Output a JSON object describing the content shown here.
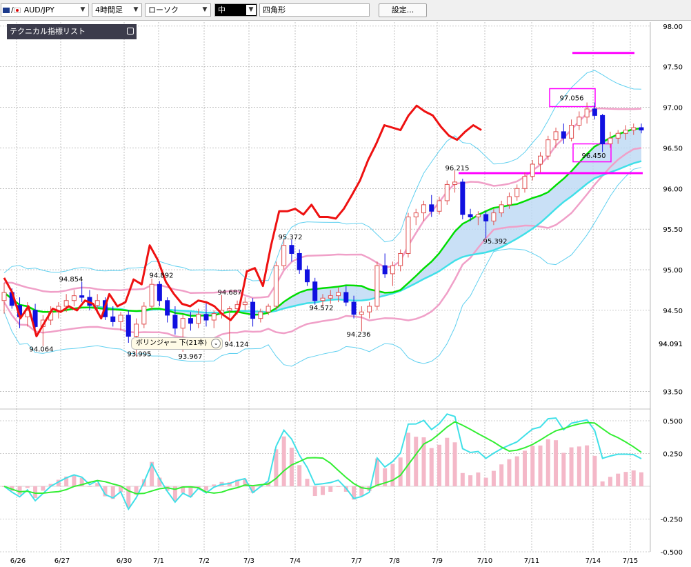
{
  "toolbar": {
    "symbol": "AUD/JPY",
    "timeframe": "4時間足",
    "chart_type": "ローソク",
    "line_width": "中",
    "drawing_tool": "四角形",
    "settings_label": "設定..."
  },
  "indicator_panel": {
    "title": "テクニカル指標リスト"
  },
  "tooltip": {
    "label": "ボリンジャー 下(21本)"
  },
  "colors": {
    "up_candle": "#e05050",
    "down_candle": "#1010e0",
    "bb_mid": "#00dd00",
    "bb_1": "#f0a0c8",
    "bb_2": "#60d0f0",
    "price_line": "#ee1111",
    "annotation": "#ff00ff",
    "macd_hist": "#f4b8c8",
    "macd_line": "#40e0e8",
    "signal_line": "#33ee33"
  },
  "chart_data": [
    {
      "type": "candlestick",
      "x_labels": [
        "6/26",
        "6/27",
        "6/30",
        "7/1",
        "7/2",
        "7/3",
        "7/4",
        "7/7",
        "7/8",
        "7/9",
        "7/10",
        "7/11",
        "7/14",
        "7/15"
      ],
      "y_ticks": [
        "98.00",
        "97.50",
        "97.00",
        "96.50",
        "96.00",
        "95.50",
        "95.00",
        "94.50",
        "94.091",
        "93.50"
      ],
      "ylim": [
        93.42,
        98.05
      ],
      "current_price": "94.091",
      "candles": [
        {
          "o": 94.62,
          "h": 94.84,
          "l": 94.46,
          "c": 94.72
        },
        {
          "o": 94.72,
          "h": 94.77,
          "l": 94.52,
          "c": 94.56
        },
        {
          "o": 94.56,
          "h": 94.66,
          "l": 94.28,
          "c": 94.42
        },
        {
          "o": 94.42,
          "h": 94.6,
          "l": 94.3,
          "c": 94.5
        },
        {
          "o": 94.5,
          "h": 94.58,
          "l": 94.2,
          "c": 94.3
        },
        {
          "o": 94.3,
          "h": 94.44,
          "l": 94.06,
          "c": 94.38
        },
        {
          "o": 94.38,
          "h": 94.55,
          "l": 94.32,
          "c": 94.48
        },
        {
          "o": 94.48,
          "h": 94.6,
          "l": 94.4,
          "c": 94.55
        },
        {
          "o": 94.55,
          "h": 94.7,
          "l": 94.48,
          "c": 94.62
        },
        {
          "o": 94.62,
          "h": 94.75,
          "l": 94.55,
          "c": 94.68
        },
        {
          "o": 94.68,
          "h": 94.85,
          "l": 94.6,
          "c": 94.66
        },
        {
          "o": 94.66,
          "h": 94.75,
          "l": 94.5,
          "c": 94.56
        },
        {
          "o": 94.56,
          "h": 94.7,
          "l": 94.5,
          "c": 94.62
        },
        {
          "o": 94.62,
          "h": 94.66,
          "l": 94.38,
          "c": 94.42
        },
        {
          "o": 94.42,
          "h": 94.55,
          "l": 94.3,
          "c": 94.36
        },
        {
          "o": 94.36,
          "h": 94.48,
          "l": 94.25,
          "c": 94.44
        },
        {
          "o": 94.44,
          "h": 94.5,
          "l": 94.1,
          "c": 94.18
        },
        {
          "o": 94.18,
          "h": 94.4,
          "l": 93.93,
          "c": 94.33
        },
        {
          "o": 94.33,
          "h": 94.6,
          "l": 94.28,
          "c": 94.55
        },
        {
          "o": 94.55,
          "h": 94.89,
          "l": 94.5,
          "c": 94.82
        },
        {
          "o": 94.82,
          "h": 94.86,
          "l": 94.55,
          "c": 94.62
        },
        {
          "o": 94.62,
          "h": 94.66,
          "l": 94.35,
          "c": 94.44
        },
        {
          "o": 94.44,
          "h": 94.55,
          "l": 94.2,
          "c": 94.28
        },
        {
          "o": 94.28,
          "h": 94.45,
          "l": 93.99,
          "c": 94.4
        },
        {
          "o": 94.4,
          "h": 94.48,
          "l": 94.25,
          "c": 94.34
        },
        {
          "o": 94.34,
          "h": 94.52,
          "l": 94.28,
          "c": 94.45
        },
        {
          "o": 94.45,
          "h": 94.6,
          "l": 94.3,
          "c": 94.38
        },
        {
          "o": 94.38,
          "h": 94.5,
          "l": 94.28,
          "c": 94.46
        },
        {
          "o": 94.46,
          "h": 94.69,
          "l": 94.4,
          "c": 94.5
        },
        {
          "o": 94.5,
          "h": 94.55,
          "l": 94.12,
          "c": 94.52
        },
        {
          "o": 94.52,
          "h": 94.62,
          "l": 94.45,
          "c": 94.57
        },
        {
          "o": 94.57,
          "h": 94.66,
          "l": 94.5,
          "c": 94.6
        },
        {
          "o": 94.6,
          "h": 94.65,
          "l": 94.3,
          "c": 94.4
        },
        {
          "o": 94.4,
          "h": 94.52,
          "l": 94.35,
          "c": 94.48
        },
        {
          "o": 94.48,
          "h": 94.58,
          "l": 94.44,
          "c": 94.55
        },
        {
          "o": 94.55,
          "h": 95.1,
          "l": 94.5,
          "c": 95.05
        },
        {
          "o": 95.05,
          "h": 95.37,
          "l": 95.0,
          "c": 95.3
        },
        {
          "o": 95.3,
          "h": 95.37,
          "l": 95.1,
          "c": 95.2
        },
        {
          "o": 95.2,
          "h": 95.25,
          "l": 94.95,
          "c": 95.0
        },
        {
          "o": 95.0,
          "h": 95.05,
          "l": 94.8,
          "c": 94.85
        },
        {
          "o": 94.85,
          "h": 94.9,
          "l": 94.57,
          "c": 94.62
        },
        {
          "o": 94.62,
          "h": 94.7,
          "l": 94.55,
          "c": 94.65
        },
        {
          "o": 94.65,
          "h": 94.75,
          "l": 94.58,
          "c": 94.68
        },
        {
          "o": 94.68,
          "h": 94.78,
          "l": 94.6,
          "c": 94.72
        },
        {
          "o": 94.72,
          "h": 94.8,
          "l": 94.55,
          "c": 94.6
        },
        {
          "o": 94.6,
          "h": 94.68,
          "l": 94.4,
          "c": 94.45
        },
        {
          "o": 94.45,
          "h": 94.55,
          "l": 94.24,
          "c": 94.48
        },
        {
          "o": 94.48,
          "h": 94.6,
          "l": 94.4,
          "c": 94.55
        },
        {
          "o": 94.55,
          "h": 95.1,
          "l": 94.5,
          "c": 95.05
        },
        {
          "o": 95.05,
          "h": 95.2,
          "l": 94.9,
          "c": 94.95
        },
        {
          "o": 94.95,
          "h": 95.1,
          "l": 94.8,
          "c": 95.05
        },
        {
          "o": 95.05,
          "h": 95.25,
          "l": 94.98,
          "c": 95.2
        },
        {
          "o": 95.2,
          "h": 95.7,
          "l": 95.15,
          "c": 95.65
        },
        {
          "o": 95.65,
          "h": 95.75,
          "l": 95.55,
          "c": 95.7
        },
        {
          "o": 95.7,
          "h": 95.85,
          "l": 95.6,
          "c": 95.8
        },
        {
          "o": 95.8,
          "h": 95.92,
          "l": 95.65,
          "c": 95.72
        },
        {
          "o": 95.72,
          "h": 95.9,
          "l": 95.68,
          "c": 95.85
        },
        {
          "o": 95.85,
          "h": 96.1,
          "l": 95.8,
          "c": 96.05
        },
        {
          "o": 96.05,
          "h": 96.22,
          "l": 95.95,
          "c": 96.08
        },
        {
          "o": 96.08,
          "h": 96.12,
          "l": 95.62,
          "c": 95.68
        },
        {
          "o": 95.68,
          "h": 95.75,
          "l": 95.6,
          "c": 95.65
        },
        {
          "o": 95.65,
          "h": 95.72,
          "l": 95.55,
          "c": 95.68
        },
        {
          "o": 95.68,
          "h": 95.72,
          "l": 95.39,
          "c": 95.6
        },
        {
          "o": 95.6,
          "h": 95.75,
          "l": 95.55,
          "c": 95.7
        },
        {
          "o": 95.7,
          "h": 95.85,
          "l": 95.65,
          "c": 95.8
        },
        {
          "o": 95.8,
          "h": 95.95,
          "l": 95.75,
          "c": 95.9
        },
        {
          "o": 95.9,
          "h": 96.05,
          "l": 95.85,
          "c": 96.0
        },
        {
          "o": 96.0,
          "h": 96.2,
          "l": 95.95,
          "c": 96.15
        },
        {
          "o": 96.15,
          "h": 96.35,
          "l": 96.1,
          "c": 96.3
        },
        {
          "o": 96.3,
          "h": 96.45,
          "l": 96.2,
          "c": 96.4
        },
        {
          "o": 96.4,
          "h": 96.65,
          "l": 96.35,
          "c": 96.6
        },
        {
          "o": 96.6,
          "h": 96.75,
          "l": 96.5,
          "c": 96.7
        },
        {
          "o": 96.7,
          "h": 96.8,
          "l": 96.55,
          "c": 96.62
        },
        {
          "o": 96.62,
          "h": 96.85,
          "l": 96.58,
          "c": 96.78
        },
        {
          "o": 96.78,
          "h": 96.95,
          "l": 96.72,
          "c": 96.88
        },
        {
          "o": 96.88,
          "h": 97.06,
          "l": 96.8,
          "c": 96.98
        },
        {
          "o": 96.98,
          "h": 97.06,
          "l": 96.85,
          "c": 96.9
        },
        {
          "o": 96.9,
          "h": 96.92,
          "l": 96.45,
          "c": 96.55
        },
        {
          "o": 96.55,
          "h": 96.7,
          "l": 96.5,
          "c": 96.62
        },
        {
          "o": 96.62,
          "h": 96.72,
          "l": 96.55,
          "c": 96.68
        },
        {
          "o": 96.68,
          "h": 96.78,
          "l": 96.6,
          "c": 96.72
        },
        {
          "o": 96.72,
          "h": 96.8,
          "l": 96.66,
          "c": 96.75
        },
        {
          "o": 96.75,
          "h": 96.8,
          "l": 96.68,
          "c": 96.72
        }
      ],
      "series": [
        {
          "name": "close_line",
          "values": [
            94.9,
            94.72,
            94.4,
            94.55,
            94.18,
            94.35,
            94.52,
            94.48,
            94.55,
            94.5,
            94.62,
            94.58,
            94.4,
            94.7,
            94.55,
            94.6,
            94.88,
            94.82,
            95.3,
            95.12,
            94.85,
            94.7,
            94.58,
            94.55,
            94.62,
            94.6,
            94.55,
            94.45,
            94.38,
            94.5,
            94.98,
            95.02,
            94.8,
            95.3,
            95.72,
            95.72,
            95.75,
            95.68,
            95.8,
            95.65,
            95.65,
            95.63,
            95.75,
            95.92,
            96.1,
            96.35,
            96.55,
            96.78,
            96.75,
            96.72,
            96.9,
            97.02,
            96.95,
            96.9,
            96.76,
            96.65,
            96.6,
            96.7,
            96.78,
            96.72
          ]
        }
      ],
      "price_labels": [
        "94.854",
        "94.064",
        "94.892",
        "93.995",
        "93.967",
        "94.687",
        "94.124",
        "95.372",
        "94.572",
        "94.236",
        "96.215",
        "95.392",
        "97.056",
        "96.450"
      ]
    },
    {
      "type": "line",
      "y_ticks": [
        "0.500",
        "0.250",
        "-0.250",
        "-0.500"
      ],
      "ylim": [
        -0.5,
        0.5
      ]
    }
  ]
}
